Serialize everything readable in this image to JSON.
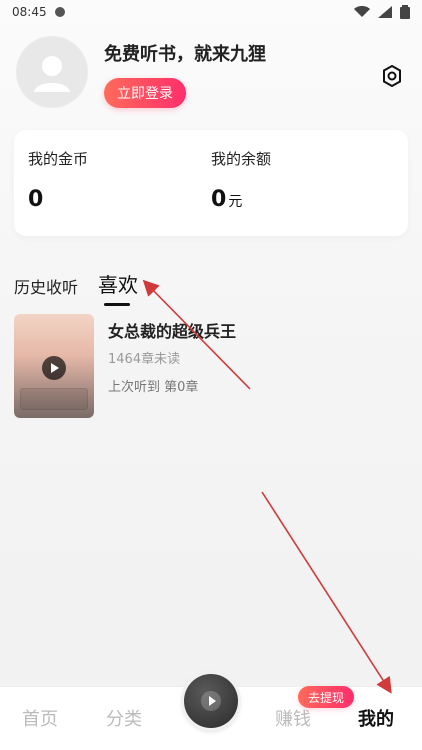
{
  "status": {
    "time": "08:45",
    "icons": [
      "dot-icon",
      "wifi-icon",
      "signal-icon",
      "battery-icon"
    ]
  },
  "profile": {
    "slogan": "免费听书，就来九狸",
    "login_label": "立即登录",
    "settings_icon": "gear-icon",
    "avatar_icon": "user-icon"
  },
  "wallet": {
    "coins_label": "我的金币",
    "coins_value": "0",
    "balance_label": "我的余额",
    "balance_value": "0",
    "balance_unit": "元"
  },
  "tabs": {
    "history": "历史收听",
    "favorites": "喜欢"
  },
  "book": {
    "title": "女总裁的超级兵王",
    "unread": "1464章未读",
    "last_listened": "上次听到 第0章",
    "cover_icon": "play-icon"
  },
  "bottom_nav": {
    "home": "首页",
    "category": "分类",
    "earn": "赚钱",
    "me": "我的",
    "withdraw": "去提现",
    "center_icon": "play-icon"
  },
  "colors": {
    "accent_start": "#ff6b5a",
    "accent_end": "#ff2e6c",
    "annotation": "#d03a3a"
  }
}
